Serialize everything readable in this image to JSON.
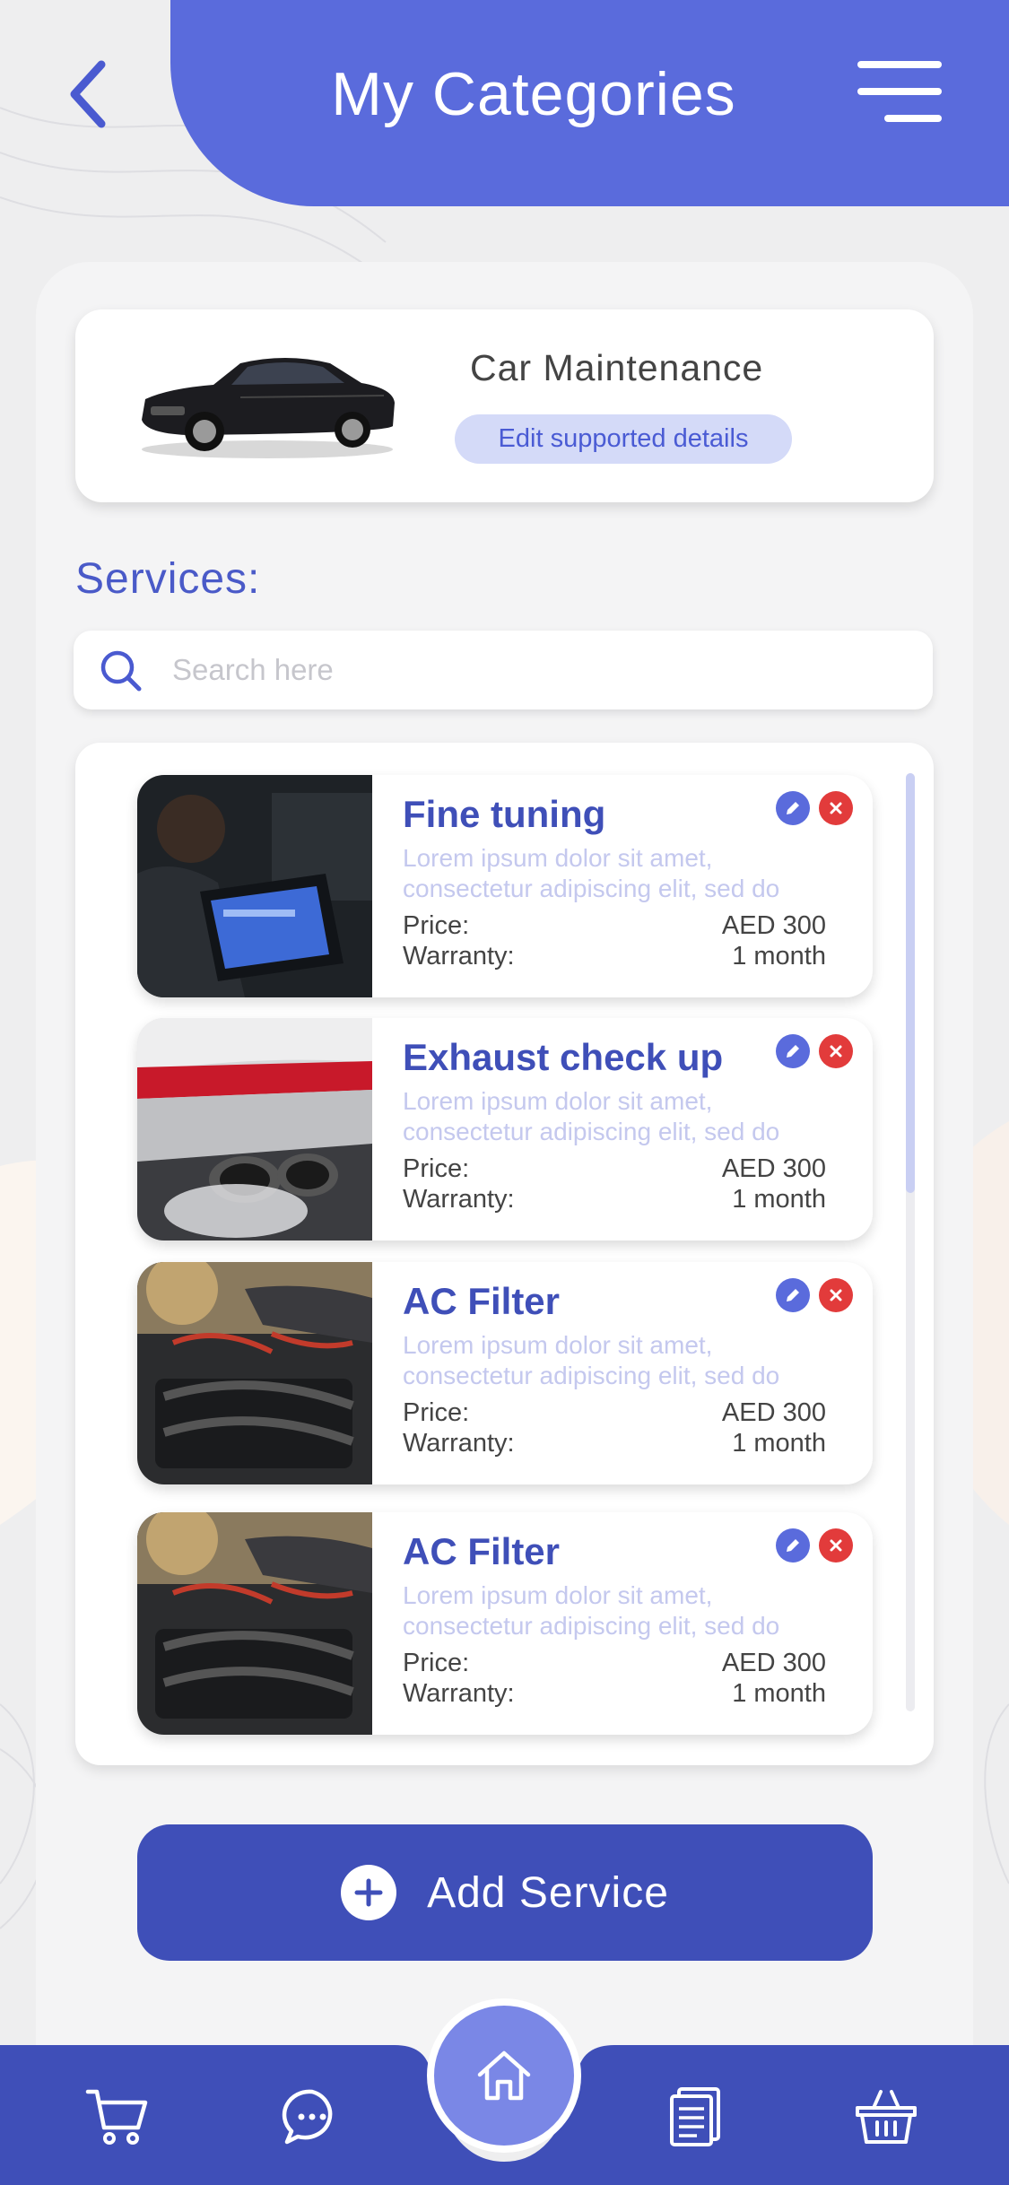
{
  "header": {
    "title": "My Categories",
    "back_icon": "chevron-left-icon",
    "menu_icon": "hamburger-menu-icon"
  },
  "category": {
    "title": "Car Maintenance",
    "edit_label": "Edit supported details"
  },
  "services": {
    "heading": "Services:",
    "search_placeholder": "Search here",
    "price_label": "Price:",
    "warranty_label": "Warranty:",
    "items": [
      {
        "name": "Fine tuning",
        "desc": "Lorem ipsum dolor sit amet, consectetur adipiscing elit, sed do",
        "price": "AED 300",
        "warranty": "1 month"
      },
      {
        "name": "Exhaust check up",
        "desc": "Lorem ipsum dolor sit amet, consectetur adipiscing elit, sed do",
        "price": "AED 300",
        "warranty": "1 month"
      },
      {
        "name": "AC Filter",
        "desc": "Lorem ipsum dolor sit amet, consectetur adipiscing elit, sed do",
        "price": "AED 300",
        "warranty": "1 month"
      },
      {
        "name": "AC Filter",
        "desc": "Lorem ipsum dolor sit amet, consectetur adipiscing elit, sed do",
        "price": "AED 300",
        "warranty": "1 month"
      }
    ]
  },
  "actions": {
    "add_label": "Add Service"
  },
  "nav": {
    "items": [
      "cart-icon",
      "chat-icon",
      "home-icon",
      "document-icon",
      "basket-icon"
    ],
    "active": "home-icon"
  },
  "colors": {
    "primary": "#5a6bdc",
    "primary_dark": "#3f4fb8",
    "delete": "#e23b3b",
    "muted_text": "#c4c8ee"
  }
}
